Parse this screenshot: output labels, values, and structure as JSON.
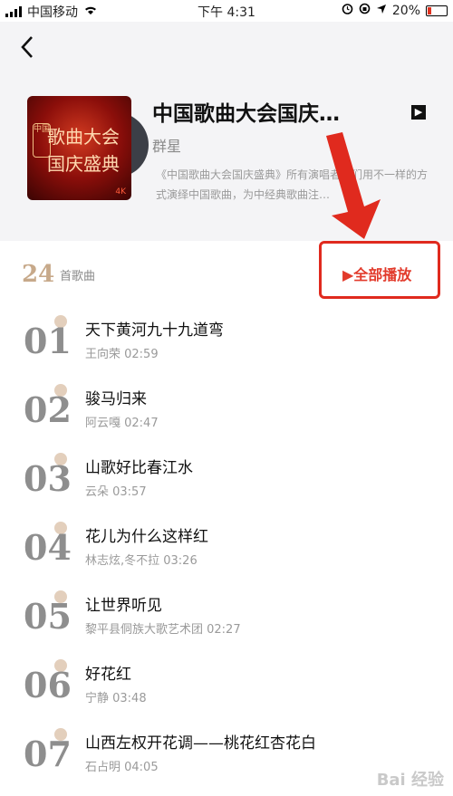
{
  "status_bar": {
    "carrier": "中国移动",
    "time": "下午 4:31",
    "battery": "20%"
  },
  "album": {
    "title": "中国歌曲大会国庆…",
    "artist": "群星",
    "description": "《中国歌曲大会国庆盛典》所有演唱者他们用不一样的方式演绎中国歌曲，为中经典歌曲注…",
    "cover_text": "歌曲大会国庆盛典",
    "cover_badge": "中国",
    "cover_corner": "4K"
  },
  "list_header": {
    "count": "24",
    "count_label": "首歌曲",
    "play_all_label": "▶全部播放"
  },
  "tracks": [
    {
      "num": "01",
      "title": "天下黄河九十九道弯",
      "meta": "王向荣 02:59"
    },
    {
      "num": "02",
      "title": "骏马归来",
      "meta": "阿云嘎 02:47"
    },
    {
      "num": "03",
      "title": "山歌好比春江水",
      "meta": "云朵 03:57"
    },
    {
      "num": "04",
      "title": "花儿为什么这样红",
      "meta": "林志炫,冬不拉 03:26"
    },
    {
      "num": "05",
      "title": "让世界听见",
      "meta": "黎平县侗族大歌艺术团 02:27"
    },
    {
      "num": "06",
      "title": "好花红",
      "meta": "宁静 03:48"
    },
    {
      "num": "07",
      "title": "山西左权开花调——桃花红杏花白",
      "meta": "石占明 04:05"
    }
  ],
  "watermark": "Bai 经验",
  "colors": {
    "accent": "#e23a2b",
    "count": "#c7a98a",
    "header_bg": "#f4f4f6"
  }
}
